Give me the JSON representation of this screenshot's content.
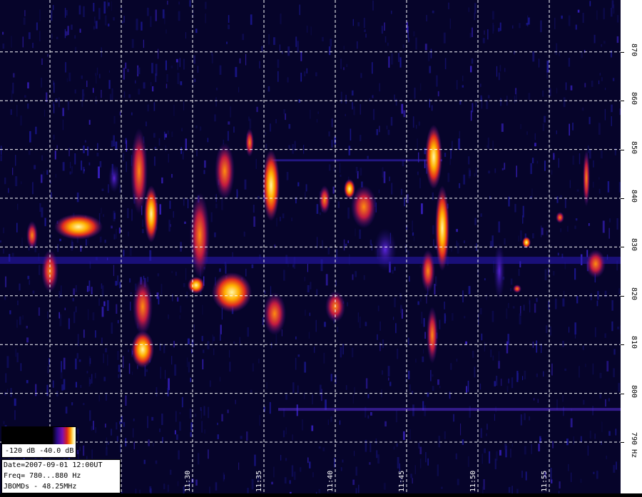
{
  "chart_data": {
    "type": "heatmap",
    "title": "",
    "xlabel": "",
    "ylabel": "",
    "y_unit": "Hz",
    "y_ticks": [
      790,
      800,
      810,
      820,
      830,
      840,
      850,
      860,
      870
    ],
    "y_tick_labels": [
      "790 Hz",
      "800",
      "810",
      "820",
      "830",
      "840",
      "850",
      "860",
      "870"
    ],
    "ylim": [
      780,
      880
    ],
    "x_ticks": [
      "11:30",
      "11:35",
      "11:40",
      "11:45",
      "11:50",
      "11:55"
    ],
    "grid": true,
    "colorscale": {
      "min_label": "-120 dB",
      "max_label": "-40.0 dB",
      "min_db": -120,
      "max_db": -40
    },
    "info": {
      "date": "Date=2007-09-01 12:00UT",
      "freq": "Freq= 780...880 Hz",
      "station": "JBOMDs - 48.25MHz"
    }
  }
}
